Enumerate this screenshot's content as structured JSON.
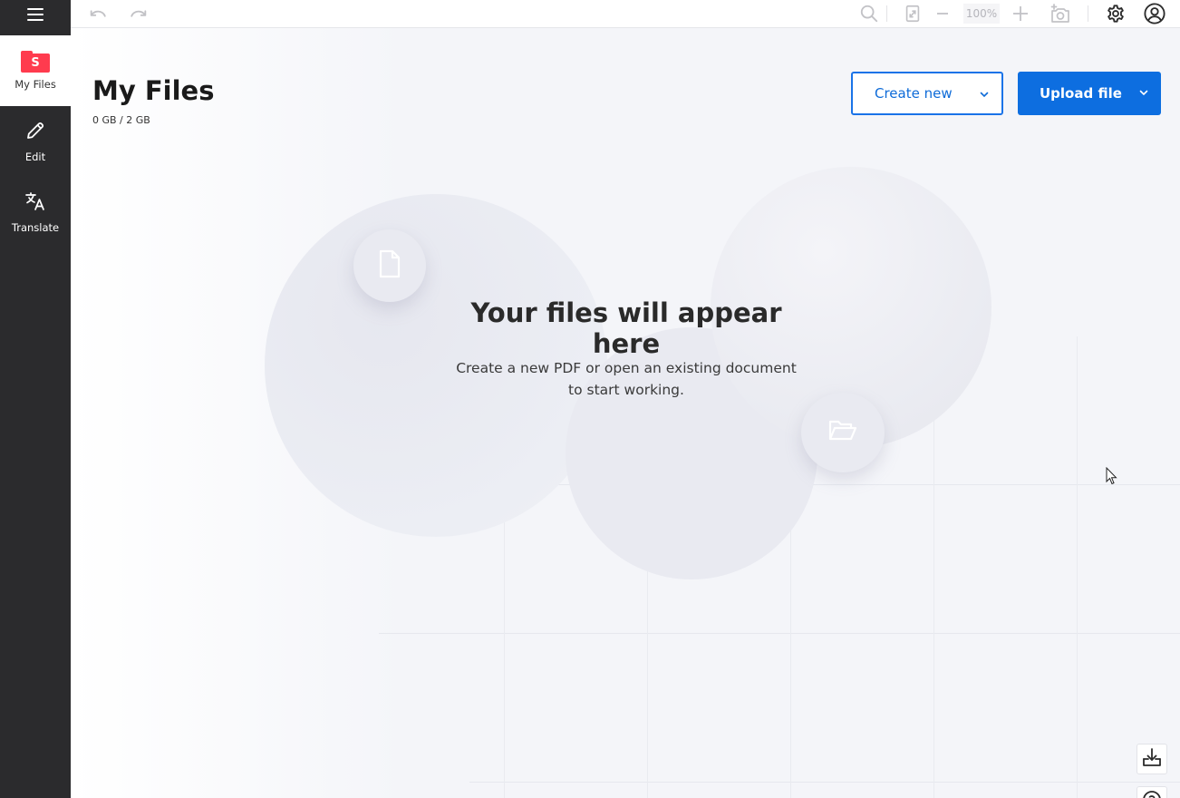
{
  "sidebar": {
    "items": [
      {
        "label": "My Files",
        "badge": "S",
        "icon": "folder-icon",
        "active": true
      },
      {
        "label": "Edit",
        "icon": "pencil-icon"
      },
      {
        "label": "Translate",
        "icon": "translate-icon"
      }
    ]
  },
  "topbar": {
    "zoom": "100%",
    "icons": [
      "undo-icon",
      "redo-icon",
      "search-icon",
      "fit-page-icon",
      "zoom-out-icon",
      "zoom-in-icon",
      "add-image-icon",
      "gear-icon",
      "account-icon"
    ]
  },
  "main": {
    "title": "My Files",
    "storage": "0 GB / 2 GB",
    "create_button": "Create new",
    "upload_button": "Upload file",
    "empty_title": "Your files will appear here",
    "empty_desc_line1": "Create a new PDF or open an existing document",
    "empty_desc_line2": "to start working."
  },
  "colors": {
    "accent": "#0d6ee0",
    "brand_red": "#ff3b4e",
    "sidebar_bg": "#2b2b2d"
  }
}
